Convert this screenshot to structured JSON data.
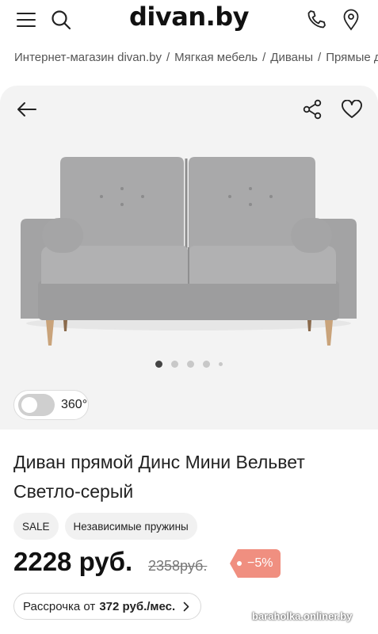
{
  "header": {
    "logo_text": "divan.by",
    "icons": [
      "menu-icon",
      "search-icon",
      "phone-icon",
      "location-pin-icon"
    ]
  },
  "breadcrumb": {
    "items": [
      "Интернет-магазин divan.by",
      "Мягкая мебель",
      "Диваны",
      "Прямые диваны"
    ]
  },
  "gallery": {
    "dots_total": 5,
    "active_dot": 1,
    "toggle_360_label": "360°",
    "sofa_colors": {
      "fabric": "#a7a7a8",
      "fabric_dark": "#8f8f90",
      "legs": "#c9a37a"
    }
  },
  "product": {
    "title": "Диван прямой Динс Мини Вельвет Светло-серый",
    "tags": [
      "SALE",
      "Независимые пружины"
    ],
    "price": "2228 руб.",
    "old_price": "2358руб.",
    "discount": "−5%",
    "installment": {
      "prefix": "Рассрочка от",
      "amount": "372 руб./мес."
    }
  },
  "watermark": "baraholka.onliner.by",
  "colors": {
    "accent": "#f08f80",
    "text": "#1a1a1a",
    "gallery_bg": "#f3f3f3"
  }
}
